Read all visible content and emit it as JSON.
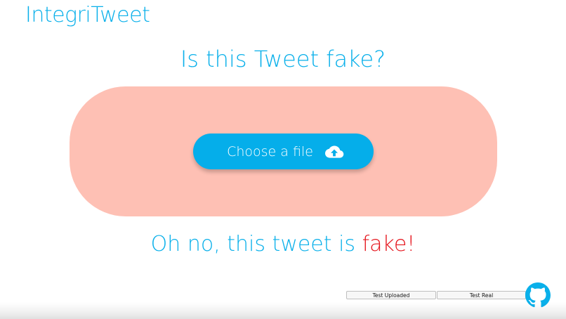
{
  "header": {
    "logo_text": "IntegriTweet"
  },
  "main": {
    "headline": "Is this Tweet fake?",
    "upload": {
      "button_label": "Choose a file",
      "icon": "cloud-upload-icon"
    },
    "result": {
      "prefix": "Oh no, this tweet is ",
      "verdict": "fake",
      "suffix": "!"
    }
  },
  "footer": {
    "test_uploaded_label": "Test Uploaded",
    "test_real_label": "Test Real",
    "github_icon": "github-icon"
  },
  "colors": {
    "accent": "#0ab0ea",
    "button": "#05aeea",
    "drop_zone": "#fec0b4",
    "verdict_fake": "#e5141c"
  }
}
